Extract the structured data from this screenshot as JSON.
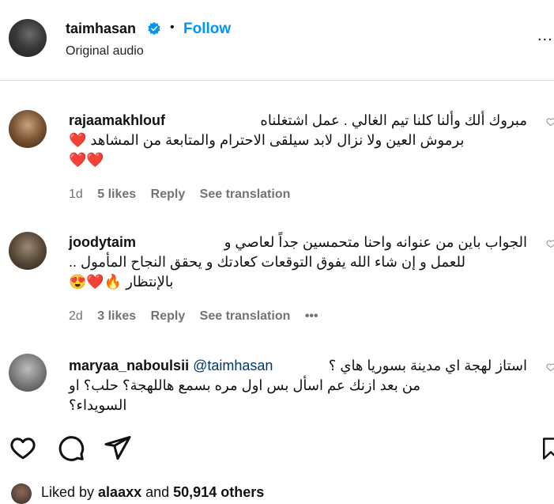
{
  "header": {
    "username": "taimhasan",
    "separator": "•",
    "follow_label": "Follow",
    "subtitle": "Original audio",
    "more_label": "..."
  },
  "comments": [
    {
      "username": "rajaamakhlouf",
      "lines": [
        "مبروك ألك وألنا كلنا تيم الغالي . عمل اشتغلناه",
        "برموش العين ولا نزال لابد سيلقى الاحترام والمتابعة من المشاهد ❤️",
        "❤️❤️"
      ],
      "time": "1d",
      "likes": "5 likes",
      "reply": "Reply",
      "translate": "See translation"
    },
    {
      "username": "joodytaim",
      "lines": [
        "الجواب باين من عنوانه واحنا متحمسين جداً لعاصي و",
        "للعمل و إن شاء الله يفوق التوقعات كعادتك و يحقق النجاح المأمول ..",
        "بالإنتظار 🔥❤️😍"
      ],
      "time": "2d",
      "likes": "3 likes",
      "reply": "Reply",
      "translate": "See translation",
      "more": "•••"
    },
    {
      "username": "maryaa_naboulsii",
      "mention": "@taimhasan",
      "lines": [
        "استاز لهجة اي مدينة بسوريا هاي ؟",
        "من بعد ازنك عم اسأل بس اول مره بسمع هاللهجة؟ حلب؟ او",
        "السويداء؟"
      ]
    }
  ],
  "liked": {
    "prefix": "Liked by ",
    "user": "alaaxx",
    "middle": " and ",
    "count": "50,914 others"
  },
  "colors": {
    "link_blue": "#0095f6",
    "meta_gray": "#737373",
    "divider": "#dbdbdb"
  },
  "icons": [
    "verified-badge-icon",
    "heart-icon",
    "comment-icon",
    "share-icon",
    "save-icon"
  ]
}
